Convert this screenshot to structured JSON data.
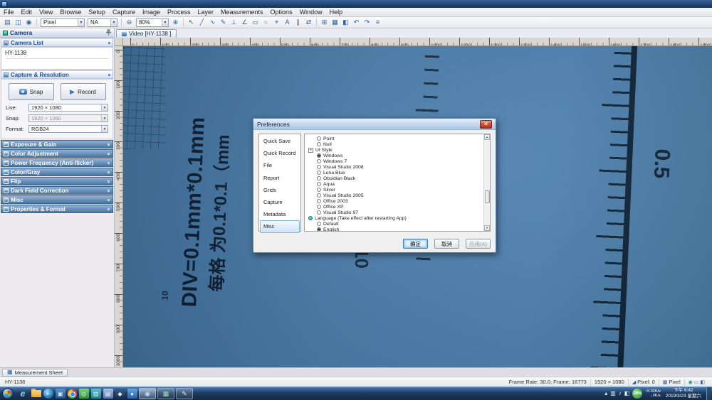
{
  "menubar": {
    "items": [
      "File",
      "Edit",
      "View",
      "Browse",
      "Setup",
      "Capture",
      "Image",
      "Process",
      "Layer",
      "Measurements",
      "Options",
      "Window",
      "Help"
    ]
  },
  "toolbar": {
    "combos": {
      "unit": "Pixel",
      "objective": "NA",
      "zoom": "80%"
    },
    "icons_file": [
      {
        "name": "open-icon",
        "glyph": "▤"
      },
      {
        "name": "save-icon",
        "glyph": "◫"
      },
      {
        "name": "snap-icon",
        "glyph": "◉"
      }
    ],
    "icons_zoom_left": [
      {
        "name": "zoom-out-icon",
        "glyph": "⊖"
      }
    ],
    "icons_zoom_right": [
      {
        "name": "zoom-in-icon",
        "glyph": "⊕"
      }
    ],
    "icons_tools": [
      {
        "name": "select-arrow-icon",
        "glyph": "↖"
      },
      {
        "name": "line-tool-icon",
        "glyph": "╱"
      },
      {
        "name": "polyline-tool-icon",
        "glyph": "∿"
      },
      {
        "name": "pencil-tool-icon",
        "glyph": "✎"
      },
      {
        "name": "perpendicular-tool-icon",
        "glyph": "⊥"
      },
      {
        "name": "angle-tool-icon",
        "glyph": "∠"
      },
      {
        "name": "rectangle-tool-icon",
        "glyph": "▭"
      },
      {
        "name": "ellipse-tool-icon",
        "glyph": "○"
      },
      {
        "name": "point-tool-icon",
        "glyph": "⌖"
      },
      {
        "name": "text-tool-icon",
        "glyph": "A"
      },
      {
        "name": "parallel-tool-icon",
        "glyph": "∥"
      },
      {
        "name": "caliper-tool-icon",
        "glyph": "⇄"
      }
    ],
    "icons_right": [
      {
        "name": "grid-icon",
        "glyph": "⊞"
      },
      {
        "name": "browse-icon",
        "glyph": "▦"
      },
      {
        "name": "layers-icon",
        "glyph": "◧"
      },
      {
        "name": "undo-icon",
        "glyph": "↶"
      },
      {
        "name": "redo-icon",
        "glyph": "↷"
      },
      {
        "name": "settings-icon",
        "glyph": "≡"
      }
    ]
  },
  "sidebar": {
    "panel_title": "Camera",
    "camera_list_header": "Camera List",
    "capture_header": "Capture & Resolution",
    "camera_name": "HY-1138",
    "capture": {
      "snap_button": "Snap",
      "record_button": "Record",
      "fields": [
        {
          "label": "Live:",
          "value": "1920 × 1080",
          "disabled": ""
        },
        {
          "label": "Snap:",
          "value": "1920 × 1080",
          "disabled": "disabled"
        },
        {
          "label": "Format:",
          "value": "RGB24",
          "disabled": ""
        }
      ]
    },
    "sections_collapsed": [
      "Exposure & Gain",
      "Color Adjustment",
      "Power Frequency (Anti-flicker)",
      "Color/Gray",
      "Flip",
      "Dark Field Correction",
      "Misc",
      "Properties & Format"
    ]
  },
  "video_tab": {
    "label": "Video [HY-1138 ]"
  },
  "rulers": {
    "horizontal": [
      "0",
      "100",
      "200",
      "300",
      "400",
      "500",
      "600",
      "700",
      "800",
      "900",
      "1000",
      "1100",
      "1200",
      "1300",
      "1400",
      "1500",
      "1600",
      "1700",
      "1800",
      "1900"
    ],
    "vertical": [
      "0",
      "100",
      "200",
      "300",
      "400",
      "500",
      "600",
      "700",
      "800",
      "900",
      "1000"
    ]
  },
  "specimen": {
    "line1": "DIV=0.1mm*0.1mm",
    "line2": "每格 为0.1*0.1（mm",
    "right_ruler_label": "0.5",
    "mid_ruler_label": "10",
    "grid_label": "10"
  },
  "dialog": {
    "title": "Preferences",
    "close_glyph": "✕",
    "nav_items": [
      {
        "label": "Quick Save",
        "cls": ""
      },
      {
        "label": "Quick Record",
        "cls": ""
      },
      {
        "label": "File",
        "cls": ""
      },
      {
        "label": "Report",
        "cls": ""
      },
      {
        "label": "Grids",
        "cls": ""
      },
      {
        "label": "Capture",
        "cls": ""
      },
      {
        "label": "Metadata",
        "cls": ""
      },
      {
        "label": "Misc",
        "cls": "selected"
      }
    ],
    "options": [
      {
        "icon": "ic-radio",
        "label": "Point",
        "ind": "ind1"
      },
      {
        "icon": "ic-radio",
        "label": "Null",
        "ind": "ind1"
      },
      {
        "icon": "ic-tree",
        "label": "UI Style",
        "ind": "ind0"
      },
      {
        "icon": "ic-radio-on",
        "label": "Windows",
        "ind": "ind1"
      },
      {
        "icon": "ic-radio",
        "label": "Windows 7",
        "ind": "ind1"
      },
      {
        "icon": "ic-radio",
        "label": "Visual Studio 2008",
        "ind": "ind1"
      },
      {
        "icon": "ic-radio",
        "label": "Luna Blue",
        "ind": "ind1"
      },
      {
        "icon": "ic-radio",
        "label": "Obsidian Black",
        "ind": "ind1"
      },
      {
        "icon": "ic-radio",
        "label": "Aqua",
        "ind": "ind1"
      },
      {
        "icon": "ic-radio",
        "label": "Silver",
        "ind": "ind1"
      },
      {
        "icon": "ic-radio",
        "label": "Visual Studio 2005",
        "ind": "ind1"
      },
      {
        "icon": "ic-radio",
        "label": "Office 2003",
        "ind": "ind1"
      },
      {
        "icon": "ic-radio",
        "label": "Office XP",
        "ind": "ind1"
      },
      {
        "icon": "ic-radio",
        "label": "Visual Studio 97",
        "ind": "ind1"
      },
      {
        "icon": "ic-bullet",
        "label": "Language (Take effect after restarting App)",
        "ind": "ind0"
      },
      {
        "icon": "ic-radio",
        "label": "Default",
        "ind": "ind1"
      },
      {
        "icon": "ic-radio-on",
        "label": "English",
        "ind": "ind1"
      }
    ],
    "buttons": [
      {
        "label": "确定",
        "cls": "btn-default"
      },
      {
        "label": "取消",
        "cls": ""
      },
      {
        "label": "应用(A)",
        "cls": "btn-disabled"
      }
    ]
  },
  "sheet_tab": {
    "label": "Measurement Sheet"
  },
  "statusbar": {
    "camera": "HY-1138",
    "frame_info": "Frame Rate: 30.0; Frame: 16773",
    "resolution": "1920 × 1080",
    "pixel_value": "Pixel: 0",
    "pixel_label": "Pixel"
  },
  "taskbar": {
    "quicklaunch": [
      {
        "name": "internet-explorer-icon",
        "cls": "tb-ie",
        "glyph": "e"
      },
      {
        "name": "folder-icon",
        "cls": "tb-folder",
        "glyph": ""
      },
      {
        "name": "media-player-icon",
        "cls": "tb-wmp",
        "glyph": "▸"
      },
      {
        "name": "app-blue-icon",
        "cls": "tb-app1",
        "glyph": "▣"
      },
      {
        "name": "chrome-icon",
        "cls": "tb-chrome",
        "glyph": ""
      },
      {
        "name": "camera-utility-icon",
        "cls": "tb-green",
        "glyph": "◎"
      },
      {
        "name": "app-teal-icon",
        "cls": "tb-app2",
        "glyph": "▥"
      },
      {
        "name": "notepad-icon",
        "cls": "tb-app3",
        "glyph": "▤"
      },
      {
        "name": "app-navy-icon",
        "cls": "tb-app4",
        "glyph": "◆"
      },
      {
        "name": "app-azure-icon",
        "cls": "tb-app5",
        "glyph": "●"
      }
    ],
    "running": [
      {
        "name": "camera-app-task-icon",
        "cls": "tb-cam",
        "active": "active",
        "glyph": "◉"
      },
      {
        "name": "image-app-task-icon",
        "cls": "tb-img",
        "active": "",
        "glyph": "▦"
      },
      {
        "name": "paint-app-task-icon",
        "cls": "tb-paint",
        "active": "",
        "glyph": "✎"
      }
    ],
    "tray": {
      "battery": "24%",
      "net_up": "↑0.02K/s",
      "net_down": "↓0K/s",
      "time": "下午 6:42",
      "date": "2019/3/23 星期六"
    }
  }
}
